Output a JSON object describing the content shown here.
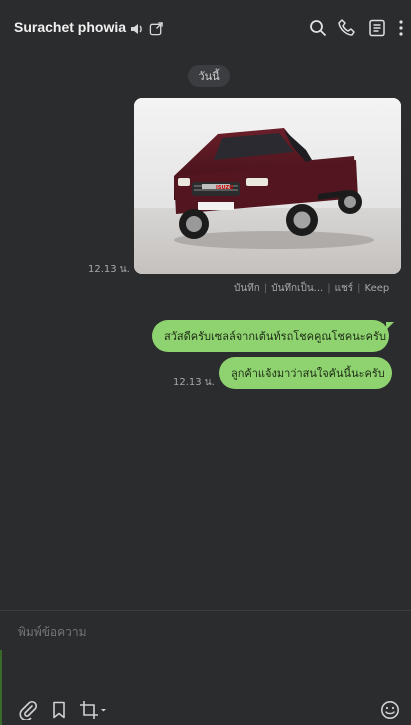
{
  "chat": {
    "title": "Surachet phowia"
  },
  "date_label": "วันนี้",
  "messages": {
    "image_time": "12.13 น.",
    "image_actions": [
      "บันทึก",
      "บันทึกเป็น...",
      "แชร์",
      "Keep"
    ],
    "text1": "สวัสดีครับเซลล์จากเต้นท์รถโชคคูณโชคนะครับ",
    "text2": "ลูกค้าแจ้งมาว่าสนใจคันนี้นะครับ",
    "text_time": "12.13 น."
  },
  "composer": {
    "placeholder": "พิมพ์ข้อความ"
  },
  "photo": {
    "badge": "ISUZU"
  }
}
